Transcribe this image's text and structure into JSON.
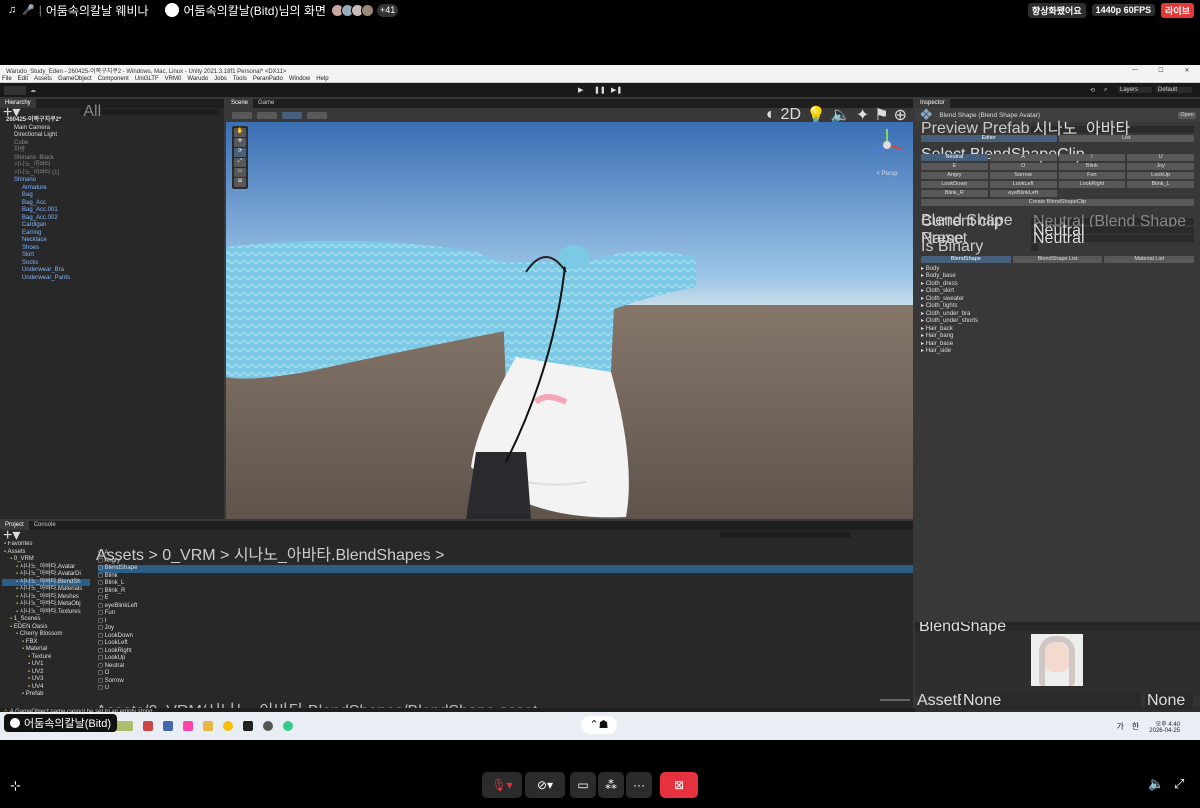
{
  "topbar": {
    "title": "어둠속의칼날 웨비나",
    "presenter": "어둠속의칼날(Bitd)님의 화면",
    "viewer_count": "+41",
    "chip_hd": "향상화됐어요",
    "chip_quality": "1440p 60FPS",
    "chip_live": "라이브"
  },
  "unity": {
    "window_title": "Warudo_Study_Eden - 260425-이쪽구치쿠2 - Windows, Mac, Linux - Unity 2021.3.18f1 Personal* <DX11>",
    "menu": [
      "File",
      "Edit",
      "Assets",
      "GameObject",
      "Component",
      "UniGLTF",
      "VRM0",
      "Warudo",
      "Jobs",
      "Tools",
      "PeranPado",
      "Window",
      "Help"
    ],
    "toolbar": {
      "layers": "Layers",
      "layout": "Default"
    },
    "hierarchy": {
      "tab": "Hierarchy",
      "search_placeholder": "All",
      "items": [
        {
          "label": "260425-이쪽구치쿠2*",
          "style": "root",
          "indent": 0
        },
        {
          "label": "Main Camera",
          "style": "",
          "indent": 1
        },
        {
          "label": "Directional Light",
          "style": "",
          "indent": 1
        },
        {
          "label": "Cube",
          "style": "dim",
          "indent": 1
        },
        {
          "label": "차량",
          "style": "dim",
          "indent": 1
        },
        {
          "label": "Shinano_Black",
          "style": "dim",
          "indent": 1
        },
        {
          "label": "시나노_아바타",
          "style": "dim",
          "indent": 1
        },
        {
          "label": "시나노_아바타 (1)",
          "style": "dim",
          "indent": 1
        },
        {
          "label": "Shinano",
          "style": "blue",
          "indent": 1
        },
        {
          "label": "Armature",
          "style": "blue",
          "indent": 2
        },
        {
          "label": "Bag",
          "style": "blue",
          "indent": 2
        },
        {
          "label": "Bag_Acc",
          "style": "blue",
          "indent": 2
        },
        {
          "label": "Bag_Acc.001",
          "style": "blue",
          "indent": 2
        },
        {
          "label": "Bag_Acc.002",
          "style": "blue",
          "indent": 2
        },
        {
          "label": "Cardigan",
          "style": "blue",
          "indent": 2
        },
        {
          "label": "Earring",
          "style": "blue",
          "indent": 2
        },
        {
          "label": "Necklace",
          "style": "blue",
          "indent": 2
        },
        {
          "label": "Shoes",
          "style": "blue",
          "indent": 2
        },
        {
          "label": "Skirt",
          "style": "blue",
          "indent": 2
        },
        {
          "label": "Socks",
          "style": "blue",
          "indent": 2
        },
        {
          "label": "Underwear_Bra",
          "style": "blue",
          "indent": 2
        },
        {
          "label": "Underwear_Pants",
          "style": "blue",
          "indent": 2
        }
      ]
    },
    "scene": {
      "tabs": [
        "Scene",
        "Game"
      ],
      "mode_2d": "2D",
      "gizmo_label": "< Persp"
    },
    "inspector": {
      "tab": "Inspector",
      "component": "Blend Shape (Blend Shape Avatar)",
      "open": "Open",
      "preview_prefab_label": "Preview Prefab",
      "preview_prefab_value": "시나노_아바타",
      "mode_tabs": [
        "Editor",
        "List"
      ],
      "select_clip_label": "Select BlendShapeClip",
      "clips": [
        "Neutral",
        "A",
        "I",
        "U",
        "E",
        "O",
        "Blink",
        "Joy",
        "Angry",
        "Sorrow",
        "Fun",
        "LookUp",
        "LookDown",
        "LookLeft",
        "LookRight",
        "Blink_L",
        "Blink_R",
        "eyeBlinkLeft"
      ],
      "create_button": "Create BlendShapeClip",
      "current_clip_label": "Current clip",
      "current_clip_value": "Neutral (Blend Shape Clip)",
      "blend_shape_name_label": "Blend Shape Name",
      "blend_shape_name_value": "Neutral",
      "preset_label": "Preset",
      "preset_value": "Neutral",
      "is_binary_label": "Is Binary",
      "sub_tabs": [
        "BlendShape",
        "BlendShape List",
        "Material List"
      ],
      "meshes": [
        "Body",
        "Body_base",
        "Cloth_dress",
        "Cloth_skirt",
        "Cloth_sweater",
        "Cloth_tights",
        "Cloth_under_bra",
        "Cloth_under_shorts",
        "Hair_back",
        "Hair_bang",
        "Hair_base",
        "Hair_side"
      ],
      "preview_title": "BlendShape",
      "assetbundle_label": "AssetBundle",
      "assetbundle_value": "None",
      "assetbundle_variant": "None"
    },
    "project": {
      "tabs": [
        "Project",
        "Console"
      ],
      "breadcrumb": "Assets > 0_VRM > 시나노_아바타.BlendShapes >",
      "tree": [
        {
          "label": "Favorites",
          "indent": 0
        },
        {
          "label": "Assets",
          "indent": 0
        },
        {
          "label": "0_VRM",
          "indent": 1
        },
        {
          "label": "시나노_아바타.Avatar",
          "indent": 2
        },
        {
          "label": "시나노_아바타.AvatarDi",
          "indent": 2
        },
        {
          "label": "시나노_아바타.BlendSh",
          "indent": 2
        },
        {
          "label": "시나노_아바타.Materials",
          "indent": 2
        },
        {
          "label": "시나노_아바타.Meshes",
          "indent": 2
        },
        {
          "label": "시나노_아바타.MetaObj",
          "indent": 2
        },
        {
          "label": "시나노_아바타.Textures",
          "indent": 2
        },
        {
          "label": "1_Scenes",
          "indent": 1
        },
        {
          "label": "EDEN Oasis",
          "indent": 1
        },
        {
          "label": "Cherry Blossom",
          "indent": 2
        },
        {
          "label": "FBX",
          "indent": 3
        },
        {
          "label": "Material",
          "indent": 3
        },
        {
          "label": "Texture",
          "indent": 4
        },
        {
          "label": "UV1",
          "indent": 4
        },
        {
          "label": "UV2",
          "indent": 4
        },
        {
          "label": "UV3",
          "indent": 4
        },
        {
          "label": "UV4",
          "indent": 4
        },
        {
          "label": "Prefab",
          "indent": 3
        }
      ],
      "files": [
        "A",
        "Angry",
        "BlendShape",
        "Blink",
        "Blink_L",
        "Blink_R",
        "E",
        "eyeBlinkLeft",
        "Fun",
        "I",
        "Joy",
        "LookDown",
        "LookLeft",
        "LookRight",
        "LookUp",
        "Neutral",
        "O",
        "Sorrow",
        "U"
      ],
      "path": "Assets/0_VRM/시나노_아바타.BlendShapes/BlendShape.asset"
    },
    "status": "A GameObject name cannot be set to an empty string.",
    "presenter_tag": "어둠속의칼날(Bitd)"
  },
  "taskbar": {
    "lang": "가",
    "ime": "한",
    "time": "오후 4:40",
    "date": "2026-04-25"
  },
  "colors": {
    "accent": "#46607c",
    "live": "#e53935",
    "stop": "#e5323e",
    "selection": "#2c5d87"
  }
}
